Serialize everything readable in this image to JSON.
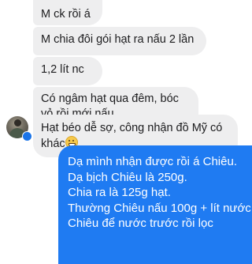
{
  "contact": {
    "avatar_icon": "person-avatar-icon",
    "online_badge_icon": "messenger-badge-icon"
  },
  "messages_in": [
    "M ck rồi á",
    "M chia đôi gói hạt ra nấu 2 lần",
    "1,2 lít nc",
    "Có ngâm hạt qua đêm, bóc vỏ rồi mới nấu",
    "Hạt béo dễ sợ, công nhận đồ Mỹ có khác"
  ],
  "emoji_icon": "grinning-sweat-emoji-icon",
  "messages_out": [
    "Dạ mình nhận được rồi á Chiêu.",
    "Dạ bịch Chiêu là 250g.",
    "Chia ra là 125g hạt.",
    "Thường Chiêu nấu 100g + lít nước.",
    "Chiêu để nước trước rồi lọc"
  ],
  "colors": {
    "incoming_bubble": "#eeeeef",
    "outgoing_bubble": "#1f7bf2",
    "badge": "#1a74e8"
  }
}
